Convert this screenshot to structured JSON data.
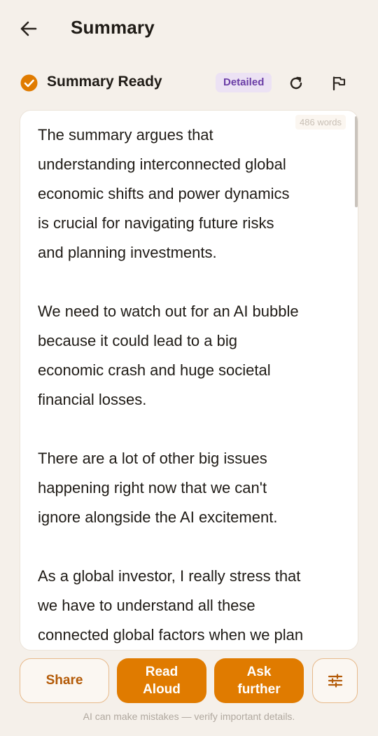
{
  "header": {
    "title": "Summary",
    "back_icon": "arrow-left-icon"
  },
  "status": {
    "text": "Summary Ready",
    "badge": "Detailed",
    "check_color": "#e07b00",
    "badge_color": "#6a3da6"
  },
  "summary": {
    "word_count": "486 words",
    "paragraphs": [
      "The summary argues that\nunderstanding interconnected global\neconomic shifts and power dynamics\nis crucial for navigating future risks\nand planning investments.",
      "We need to watch out for an AI bubble\nbecause it could lead to a big\neconomic crash and huge societal\nfinancial losses.",
      "There are a lot of other big issues\nhappening right now that we can't\nignore alongside the AI excitement.",
      "As a global investor, I really stress that\nwe have to understand all these\nconnected global factors when we plan"
    ]
  },
  "actions": {
    "share": "Share",
    "read_aloud": "Read\nAloud",
    "ask_further": "Ask\nfurther",
    "tune_icon": "sliders-icon",
    "accent": "#e07b00"
  },
  "footer": {
    "disclaimer": "AI can make mistakes — verify important details."
  }
}
